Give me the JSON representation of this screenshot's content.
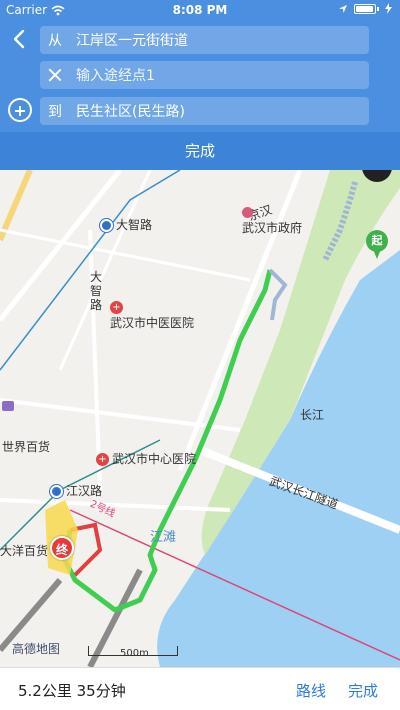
{
  "status_bar": {
    "carrier": "Carrier",
    "time": "8:08 PM"
  },
  "route": {
    "from_prefix": "从",
    "from": "江岸区一元街街道",
    "via_placeholder": "输入途经点1",
    "to_prefix": "到",
    "to": "民生社区(民生路)"
  },
  "header": {
    "done_label": "完成"
  },
  "map": {
    "labels": {
      "dazhi_rd": "大智路",
      "dazhi_rd_vertical": "大\n智\n路",
      "gov": "武汉市政府",
      "tcm_hospital": "武汉市中医医院",
      "world_dept": "世界百货",
      "central_hospital": "武汉市中心医院",
      "jianghan_rd": "江汉路",
      "dayang": "大洋百货",
      "tunnel": "武汉长江隧道",
      "changjiang": "长江",
      "jiangtan": "江滩",
      "line2": "2号线",
      "jingfeng": "京汉"
    },
    "start_marker": "起",
    "end_marker": "终",
    "logo": "高德地图",
    "scale": "500m",
    "colors": {
      "water": "#9dd0f2",
      "park": "#cfe8b7",
      "route": "#3fcf50",
      "metro": "#e0457a"
    }
  },
  "bottom": {
    "summary": "5.2公里 35分钟",
    "route_label": "路线",
    "done_label": "完成"
  }
}
